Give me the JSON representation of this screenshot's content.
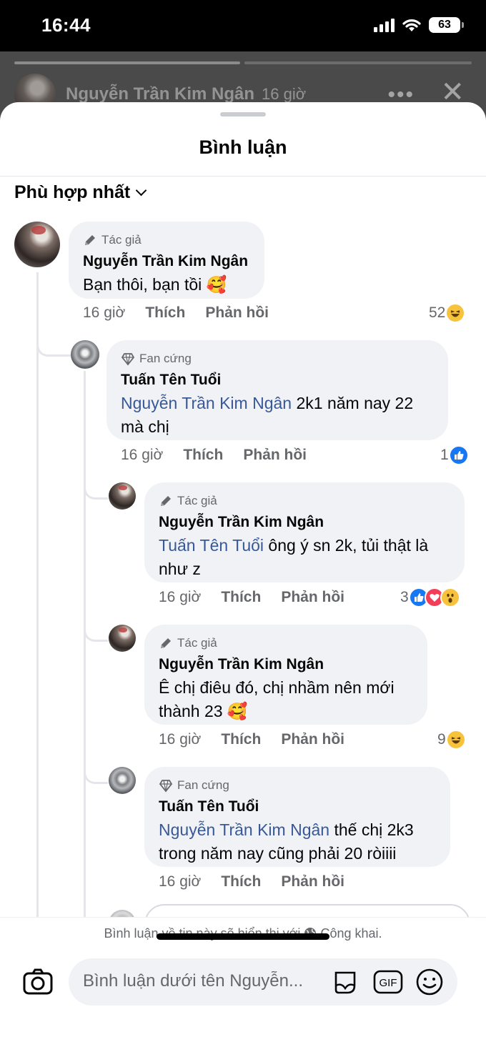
{
  "status_bar": {
    "time": "16:44",
    "battery": "63"
  },
  "story": {
    "author": "Nguyễn Trần Kim Ngân",
    "age": "16 giờ"
  },
  "sheet": {
    "title": "Bình luận",
    "sort_label": "Phù hợp nhất"
  },
  "comments": [
    {
      "badge": "Tác giả",
      "name": "Nguyễn Trần Kim Ngân",
      "mention": "",
      "text": "Bạn thôi, bạn tồi 🥰",
      "time": "16 giờ",
      "like": "Thích",
      "reply": "Phản hồi",
      "reaction_count": "52",
      "reaction_icons": [
        "haha"
      ]
    },
    {
      "badge": "Fan cứng",
      "name": "Tuấn Tên Tuổi",
      "mention": "Nguyễn Trần Kim Ngân",
      "text": " 2k1 năm nay 22 mà chị",
      "time": "16 giờ",
      "like": "Thích",
      "reply": "Phản hồi",
      "reaction_count": "1",
      "reaction_icons": [
        "like"
      ]
    },
    {
      "badge": "Tác giả",
      "name": "Nguyễn Trần Kim Ngân",
      "mention": "Tuấn Tên Tuổi",
      "text": " ông ý sn 2k, tủi thật là như z",
      "time": "16 giờ",
      "like": "Thích",
      "reply": "Phản hồi",
      "reaction_count": "3",
      "reaction_icons": [
        "like",
        "love",
        "wow"
      ]
    },
    {
      "badge": "Tác giả",
      "name": "Nguyễn Trần Kim Ngân",
      "mention": "",
      "text": "Ê chị điêu đó, chị nhầm nên mới thành 23 🥰",
      "time": "16 giờ",
      "like": "Thích",
      "reply": "Phản hồi",
      "reaction_count": "9",
      "reaction_icons": [
        "haha"
      ]
    },
    {
      "badge": "Fan cứng",
      "name": "Tuấn Tên Tuổi",
      "mention": "Nguyễn Trần Kim Ngân",
      "text": " thế chị 2k3 trong năm nay cũng phải 20 ròiiii",
      "time": "16 giờ",
      "like": "Thích",
      "reply": "Phản hồi",
      "reaction_count": "",
      "reaction_icons": []
    }
  ],
  "footer": {
    "notice_prefix": "Bình luận về tin này sẽ hiển thị với",
    "notice_audience": "Công khai.",
    "input_placeholder": "Bình luận dưới tên Nguyễn...",
    "gif_label": "GIF"
  },
  "icons": {
    "author_badge": "pencil-icon",
    "fan_badge": "diamond-icon",
    "camera": "camera-icon",
    "sticker": "sticker-icon",
    "emoji": "emoji-icon",
    "globe": "globe-icon"
  },
  "colors": {
    "mention": "#385898",
    "bubble": "#f0f2f5",
    "like": "#1877f2",
    "love": "#f33e58",
    "haha": "#f7c33c"
  }
}
